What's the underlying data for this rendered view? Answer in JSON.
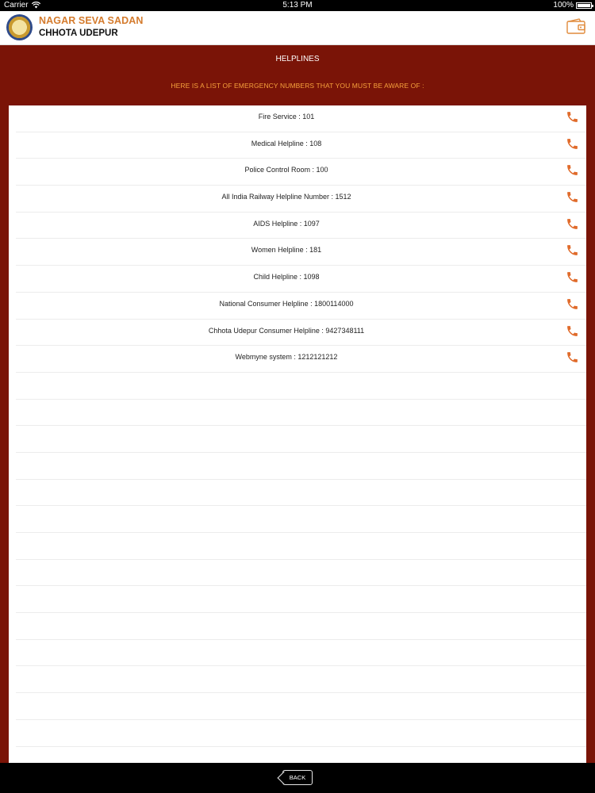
{
  "status": {
    "carrier": "Carrier",
    "time": "5:13 PM",
    "battery": "100%"
  },
  "header": {
    "title_line1": "NAGAR SEVA SADAN",
    "title_line2": "CHHOTA UDEPUR"
  },
  "page": {
    "title": "HELPLINES",
    "subtitle": "HERE IS A LIST OF EMERGENCY NUMBERS THAT YOU MUST BE AWARE OF :"
  },
  "helplines": [
    {
      "label": "Fire Service : 101"
    },
    {
      "label": "Medical Helpline : 108"
    },
    {
      "label": "Police Control Room : 100"
    },
    {
      "label": "All India Railway Helpline Number : 1512"
    },
    {
      "label": "AIDS Helpline : 1097"
    },
    {
      "label": "Women Helpline : 181"
    },
    {
      "label": "Child Helpline : 1098"
    },
    {
      "label": "National Consumer Helpline : 1800114000"
    },
    {
      "label": "Chhota Udepur Consumer Helpline : 9427348111"
    },
    {
      "label": "Webmyne system : 1212121212"
    }
  ],
  "footer": {
    "back_label": "BACK"
  },
  "colors": {
    "accent": "#e06b2b",
    "header_bg": "#7a1407",
    "brand_orange": "#d47b2d"
  },
  "icons": {
    "call": "phone-icon",
    "wallet": "wallet-icon",
    "wifi": "wifi-icon"
  }
}
